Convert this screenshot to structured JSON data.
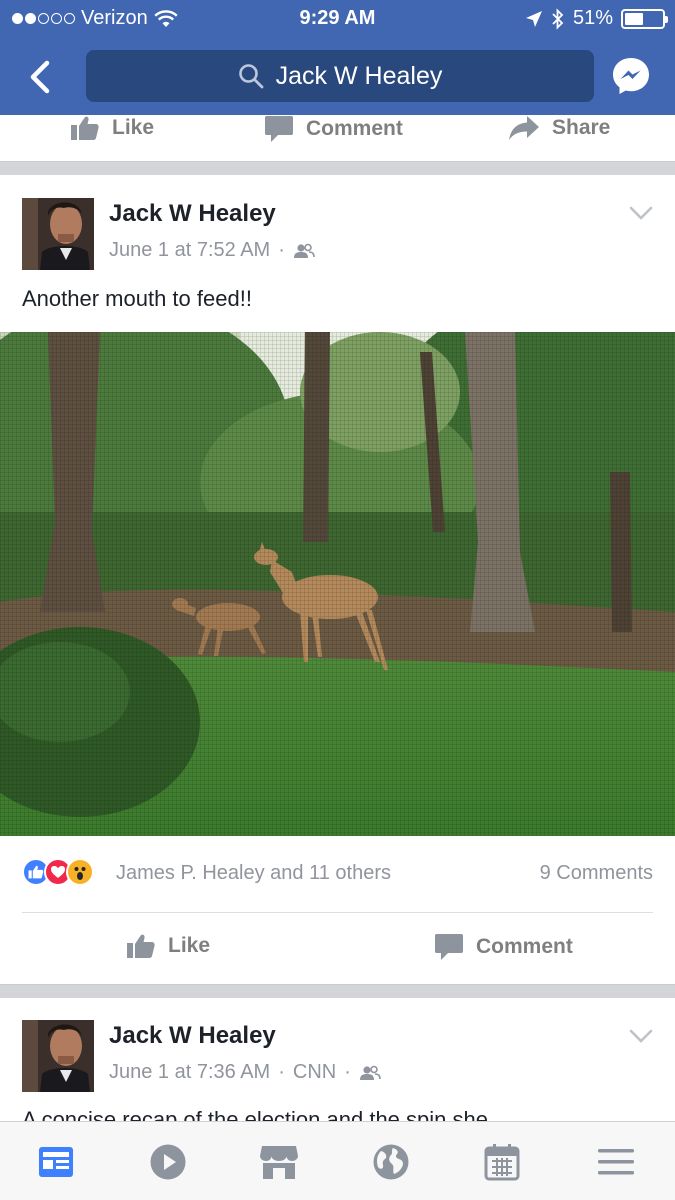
{
  "status_bar": {
    "carrier": "Verizon",
    "time": "9:29 AM",
    "battery": "51%",
    "battery_level": 0.51,
    "signal_bars_filled": 2,
    "signal_bars_total": 5
  },
  "nav": {
    "search_query": "Jack W Healey",
    "back_icon": "chevron-left-icon",
    "search_icon": "search-icon",
    "messenger_icon": "messenger-icon"
  },
  "previous_post_actions": {
    "like": "Like",
    "comment": "Comment",
    "share": "Share"
  },
  "post1": {
    "author": "Jack W Healey",
    "timestamp": "June 1 at 7:52 AM",
    "separator": "·",
    "audience_icon": "friends-icon",
    "text": "Another mouth to feed!!",
    "reactors": "James P. Healey and 11 others",
    "comments_count": "9 Comments",
    "like_label": "Like",
    "comment_label": "Comment"
  },
  "post2": {
    "author": "Jack W Healey",
    "timestamp": "June 1 at 7:36 AM",
    "separator": "·",
    "source": "CNN",
    "separator2": "·",
    "audience_icon": "friends-icon",
    "text_partial": "A concise recap of the election and the spin she"
  },
  "tab_bar": {
    "tabs": [
      "news-feed-icon",
      "video-icon",
      "marketplace-icon",
      "globe-icon",
      "calendar-icon",
      "menu-icon"
    ],
    "active_tab": "news-feed-icon"
  },
  "colors": {
    "brand_blue": "#4267b2",
    "search_bg": "#29487d",
    "meta_gray": "#90949c",
    "like_blue": "#4080ff",
    "love_red": "#f0284a",
    "wow_yellow": "#f7b125"
  }
}
